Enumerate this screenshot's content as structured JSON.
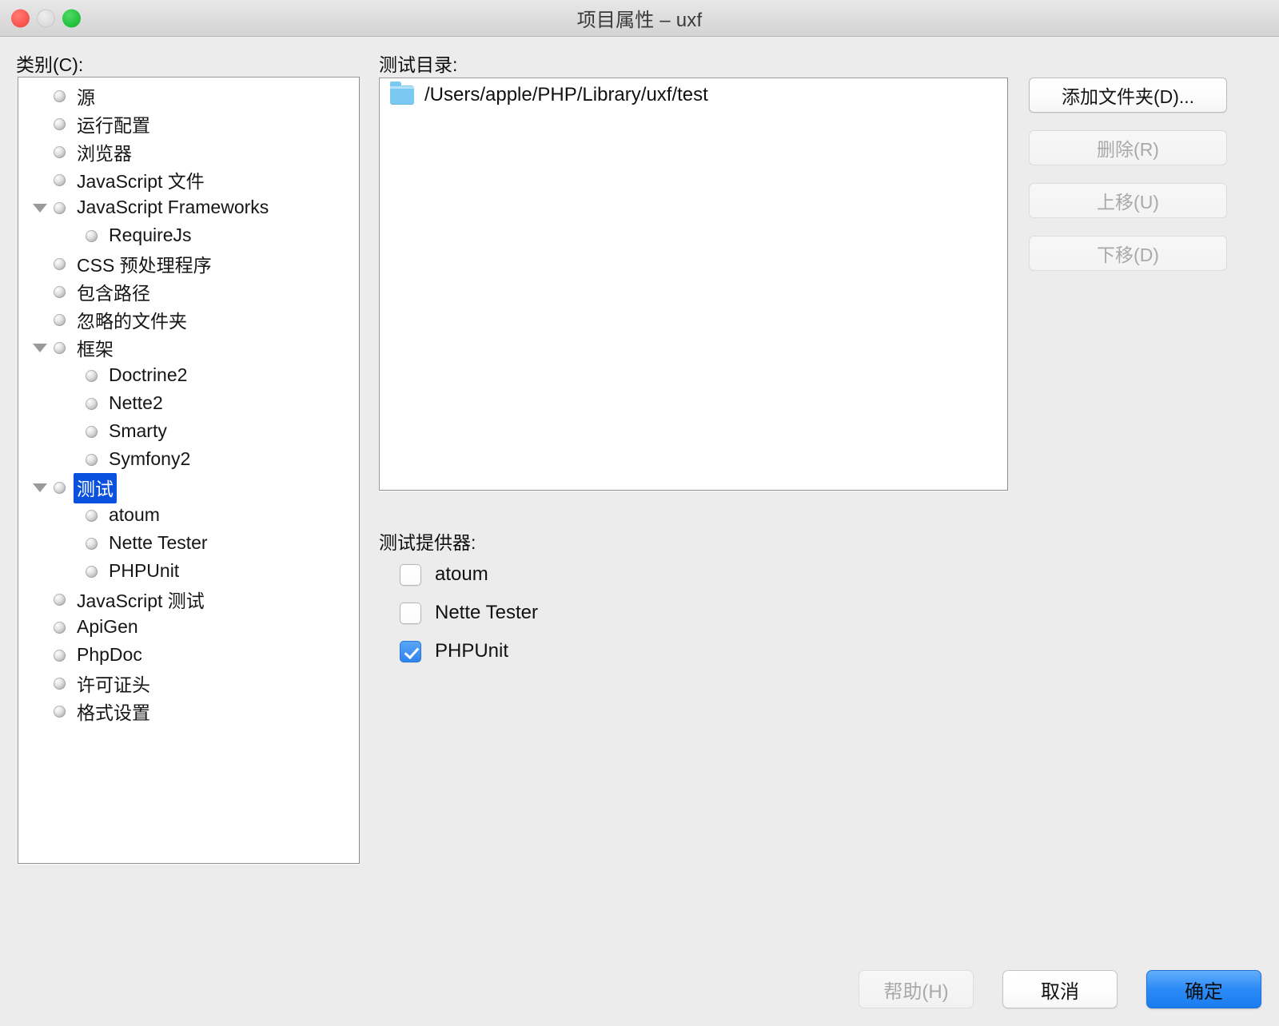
{
  "window": {
    "title": "项目属性 – uxf",
    "traffic_lights": [
      "close-button",
      "minimize-button",
      "zoom-button"
    ]
  },
  "categories": {
    "label": "类别(C):",
    "items": [
      {
        "label": "源",
        "level": 0,
        "twisty": "none",
        "selected": false
      },
      {
        "label": "运行配置",
        "level": 0,
        "twisty": "none",
        "selected": false
      },
      {
        "label": "浏览器",
        "level": 0,
        "twisty": "none",
        "selected": false
      },
      {
        "label": "JavaScript 文件",
        "level": 0,
        "twisty": "none",
        "selected": false
      },
      {
        "label": "JavaScript Frameworks",
        "level": 0,
        "twisty": "expanded",
        "selected": false
      },
      {
        "label": "RequireJs",
        "level": 1,
        "twisty": "none",
        "selected": false
      },
      {
        "label": "CSS 预处理程序",
        "level": 0,
        "twisty": "none",
        "selected": false
      },
      {
        "label": "包含路径",
        "level": 0,
        "twisty": "none",
        "selected": false
      },
      {
        "label": "忽略的文件夹",
        "level": 0,
        "twisty": "none",
        "selected": false
      },
      {
        "label": "框架",
        "level": 0,
        "twisty": "expanded",
        "selected": false
      },
      {
        "label": "Doctrine2",
        "level": 1,
        "twisty": "none",
        "selected": false
      },
      {
        "label": "Nette2",
        "level": 1,
        "twisty": "none",
        "selected": false
      },
      {
        "label": "Smarty",
        "level": 1,
        "twisty": "none",
        "selected": false
      },
      {
        "label": "Symfony2",
        "level": 1,
        "twisty": "none",
        "selected": false
      },
      {
        "label": "测试",
        "level": 0,
        "twisty": "expanded",
        "selected": true
      },
      {
        "label": "atoum",
        "level": 1,
        "twisty": "none",
        "selected": false
      },
      {
        "label": "Nette Tester",
        "level": 1,
        "twisty": "none",
        "selected": false
      },
      {
        "label": "PHPUnit",
        "level": 1,
        "twisty": "none",
        "selected": false
      },
      {
        "label": "JavaScript 测试",
        "level": 0,
        "twisty": "none",
        "selected": false
      },
      {
        "label": "ApiGen",
        "level": 0,
        "twisty": "none",
        "selected": false
      },
      {
        "label": "PhpDoc",
        "level": 0,
        "twisty": "none",
        "selected": false
      },
      {
        "label": "许可证头",
        "level": 0,
        "twisty": "none",
        "selected": false
      },
      {
        "label": "格式设置",
        "level": 0,
        "twisty": "none",
        "selected": false
      }
    ]
  },
  "test_directories": {
    "label": "测试目录:",
    "entries": [
      {
        "path": "/Users/apple/PHP/Library/uxf/test",
        "icon": "folder-icon"
      }
    ],
    "buttons": [
      {
        "label": "添加文件夹(D)...",
        "name": "add-folder-button",
        "enabled": true
      },
      {
        "label": "删除(R)",
        "name": "remove-button",
        "enabled": false
      },
      {
        "label": "上移(U)",
        "name": "move-up-button",
        "enabled": false
      },
      {
        "label": "下移(D)",
        "name": "move-down-button",
        "enabled": false
      }
    ]
  },
  "test_providers": {
    "label": "测试提供器:",
    "options": [
      {
        "label": "atoum",
        "checked": false
      },
      {
        "label": "Nette Tester",
        "checked": false
      },
      {
        "label": "PHPUnit",
        "checked": true
      }
    ]
  },
  "footer": {
    "buttons": [
      {
        "label": "帮助(H)",
        "name": "help-button",
        "enabled": false,
        "primary": false
      },
      {
        "label": "取消",
        "name": "cancel-button",
        "enabled": true,
        "primary": false
      },
      {
        "label": "确定",
        "name": "ok-button",
        "enabled": true,
        "primary": true
      }
    ]
  },
  "colors": {
    "selection_blue": "#0a51e0",
    "primary_button_blue": "#2c8cf6",
    "checkbox_blue": "#2f83ef",
    "folder_blue": "#79c9f2",
    "window_background": "#ececec"
  }
}
